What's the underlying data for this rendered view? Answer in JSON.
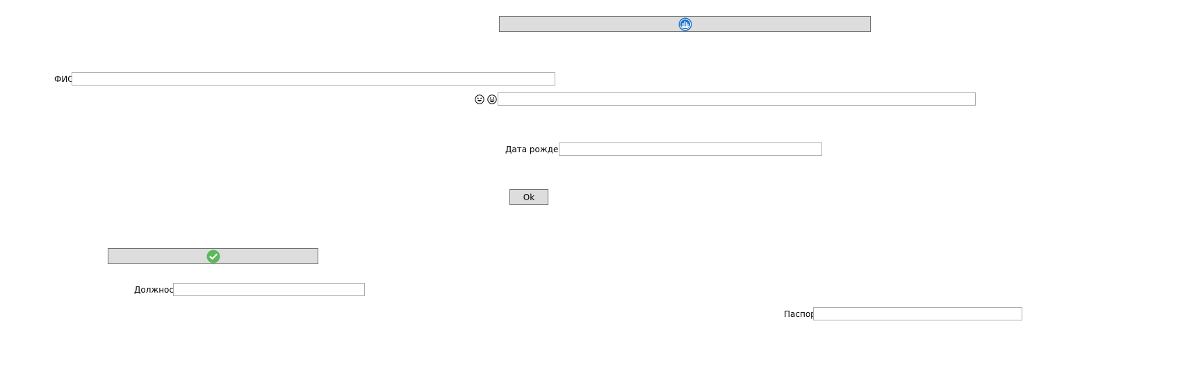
{
  "top_button": {
    "icon": "blue-circle-sailboat-icon"
  },
  "fio": {
    "label": "ФИО",
    "value": ""
  },
  "emoji_row": {
    "icons": [
      "smile-emoji-icon",
      "grin-emoji-icon"
    ],
    "value": ""
  },
  "birth_date": {
    "label": "Дата рождения",
    "value": ""
  },
  "ok_button": {
    "label": "Ok"
  },
  "check_button": {
    "icon": "green-check-circle-icon"
  },
  "position": {
    "label": "Должность",
    "value": ""
  },
  "passport": {
    "label": "Паспорт",
    "value": ""
  },
  "colors": {
    "button_bg": "#dddddd",
    "button_border": "#707070",
    "input_border": "#ababab",
    "accent_blue": "#1a73c9",
    "accent_green": "#5cb85c"
  }
}
